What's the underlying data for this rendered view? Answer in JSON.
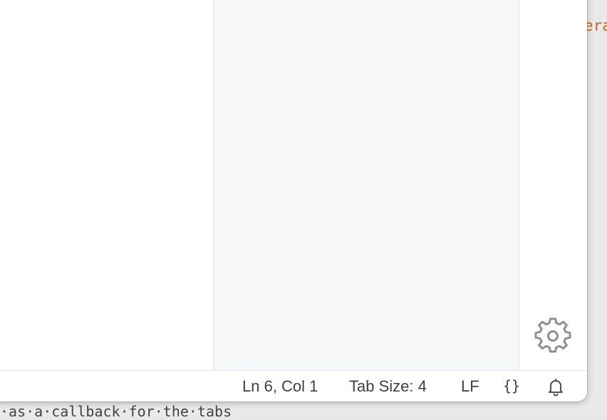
{
  "background": {
    "code_fragment_right": "era",
    "code_fragment_bottom": "·as·a·callback·for·the·tabs"
  },
  "statusbar": {
    "cursor_position": "Ln 6, Col 1",
    "tab_size": "Tab Size: 4",
    "line_ending": "LF",
    "language_mode": "{}"
  },
  "icons": {
    "settings": "gear-icon",
    "notifications": "bell-icon"
  },
  "colors": {
    "panel_background": "#f6f7f9",
    "status_text": "#3c4148",
    "icon_gray": "#8a9096",
    "code_orange": "#c8641e"
  }
}
